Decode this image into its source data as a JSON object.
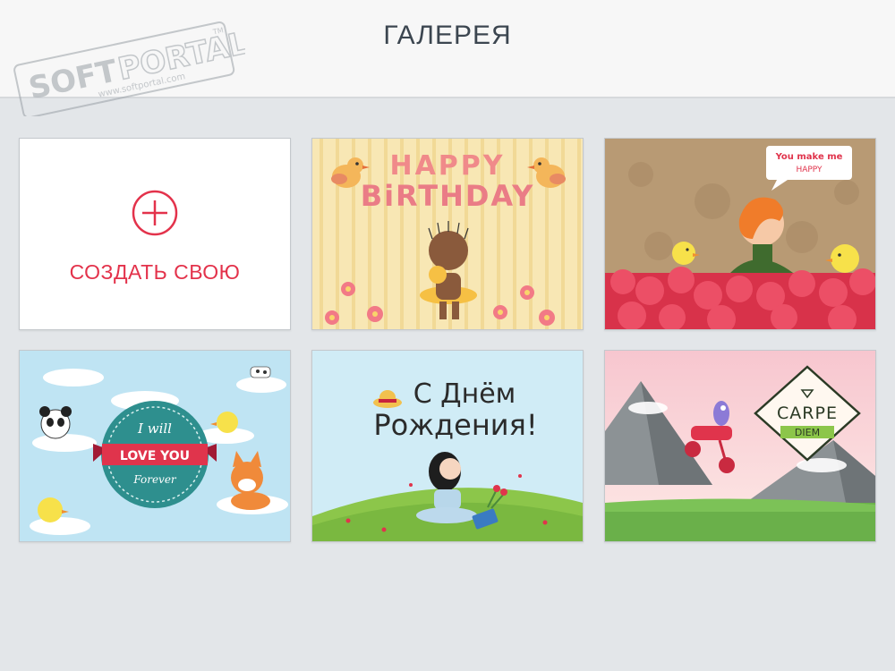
{
  "header": {
    "title": "ГАЛЕРЕЯ"
  },
  "watermark": {
    "brand_left": "SOFT",
    "brand_right": "PORTAL",
    "url": "www.softportal.com",
    "tm": "TM"
  },
  "create_card": {
    "label": "СОЗДАТЬ СВОЮ",
    "icon": "plus-circle-icon"
  },
  "cards": [
    {
      "id": "happy-birthday",
      "line1": "HAPPY",
      "line2": "BiRTHDAY"
    },
    {
      "id": "you-make-me-happy",
      "bubble_line1": "You make me",
      "bubble_line2": "HAPPY"
    },
    {
      "id": "love-you",
      "line1": "I will",
      "line2": "LOVE YOU",
      "line3": "Forever"
    },
    {
      "id": "s-dnem-rozhdeniya",
      "line1": "С Днём",
      "line2": "Рождения!"
    },
    {
      "id": "carpe-diem",
      "line1": "CARPE",
      "line2": "DIEM"
    }
  ],
  "colors": {
    "accent": "#e3324b",
    "background": "#e3e6e9",
    "header": "#f7f7f7"
  }
}
